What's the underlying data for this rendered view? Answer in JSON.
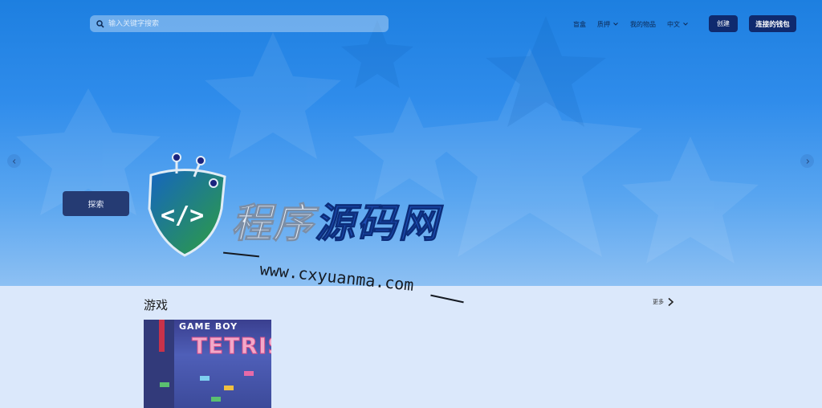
{
  "header": {
    "search_placeholder": "输入关键字搜索",
    "nav": [
      {
        "label": "盲盒",
        "has_menu": false
      },
      {
        "label": "质押",
        "has_menu": true
      },
      {
        "label": "我的物品",
        "has_menu": false
      },
      {
        "label": "中文",
        "has_menu": true
      }
    ],
    "create_label": "创建",
    "wallet_label": "连接的钱包"
  },
  "hero": {
    "explore_label": "探索",
    "watermark": {
      "title_part1": "程序",
      "title_part2": "源码网",
      "url": "www.cxyuanma.com"
    }
  },
  "games": {
    "title": "游戏",
    "more_label": "更多",
    "card": {
      "brand": "GAME BOY",
      "name": "TETRIS"
    }
  },
  "colors": {
    "hero_top": "#1d7fe0",
    "hero_bottom": "#8dc0f3",
    "button_dark": "#0f2a6e",
    "page_bg": "#dbe8fb"
  },
  "icons": [
    "search-icon",
    "chevron-down-icon",
    "chevron-left-icon",
    "chevron-right-icon"
  ]
}
